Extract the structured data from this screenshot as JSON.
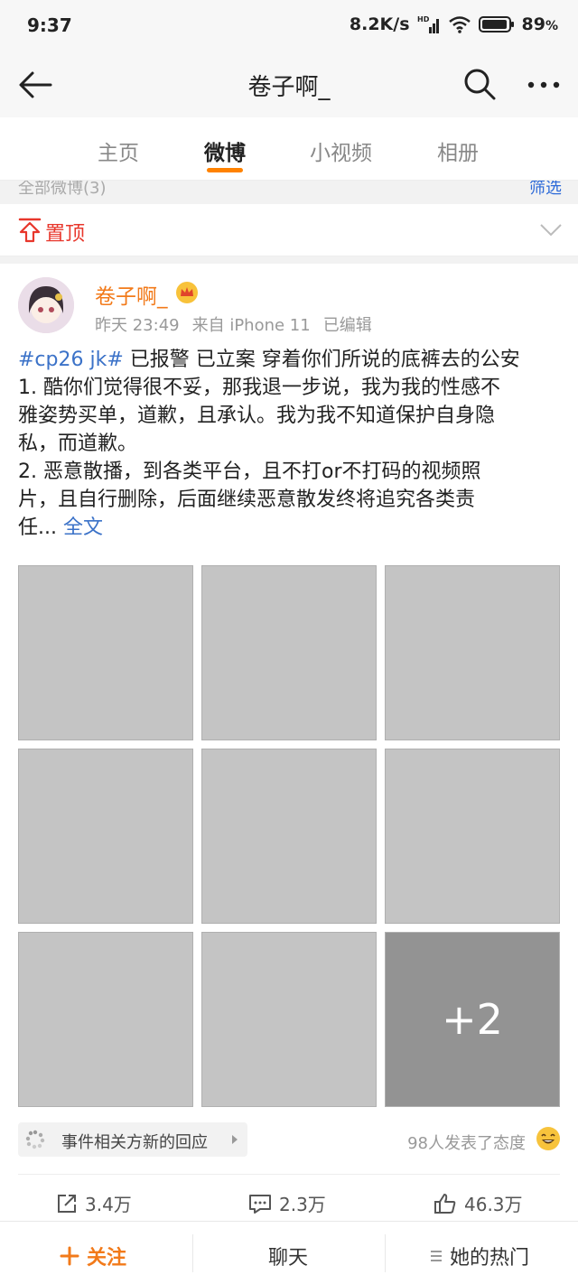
{
  "status": {
    "time": "9:37",
    "speed": "8.2K/s",
    "hd": "HD",
    "battery": "89",
    "battery_unit": "%"
  },
  "nav": {
    "title": "卷子啊_"
  },
  "tabs": [
    {
      "label": "主页"
    },
    {
      "label": "微博"
    },
    {
      "label": "小视频"
    },
    {
      "label": "相册"
    }
  ],
  "filter": {
    "left": "全部微博(3)",
    "right": "筛选"
  },
  "pinned": {
    "label": "置顶"
  },
  "post": {
    "author": "卷子啊_",
    "time": "昨天 23:49",
    "source": "来自 iPhone 11",
    "edited": "已编辑",
    "lines": {
      "l1_topic": "#cp26 jk#",
      "l1_rest": " 已报警 已立案 穿着你们所说的底裤去的公安",
      "l2": "1. 酷你们觉得很不妥，那我退一步说，我为我的性感不",
      "l3": "雅姿势买单，道歉，且承认。我为我不知道保护自身隐",
      "l4": "私，而道歉。",
      "l5": "2. 恶意散播，到各类平台，且不打or不打码的视频照",
      "l6": "片，且自行删除，后面继续恶意散发终将追究各类责",
      "l7": "任...",
      "more": "全文"
    },
    "more_images": "+2",
    "event_label": "事件相关方新的回应",
    "reactions": "98人发表了态度",
    "reposts": "3.4万",
    "comments": "2.3万",
    "likes": "46.3万"
  },
  "bottom": {
    "follow": "关注",
    "chat": "聊天",
    "hot": "她的热门"
  },
  "colors": {
    "accent": "#ff8200",
    "author": "#f27a1a",
    "link": "#3b72c8",
    "pinned": "#e8372c"
  }
}
